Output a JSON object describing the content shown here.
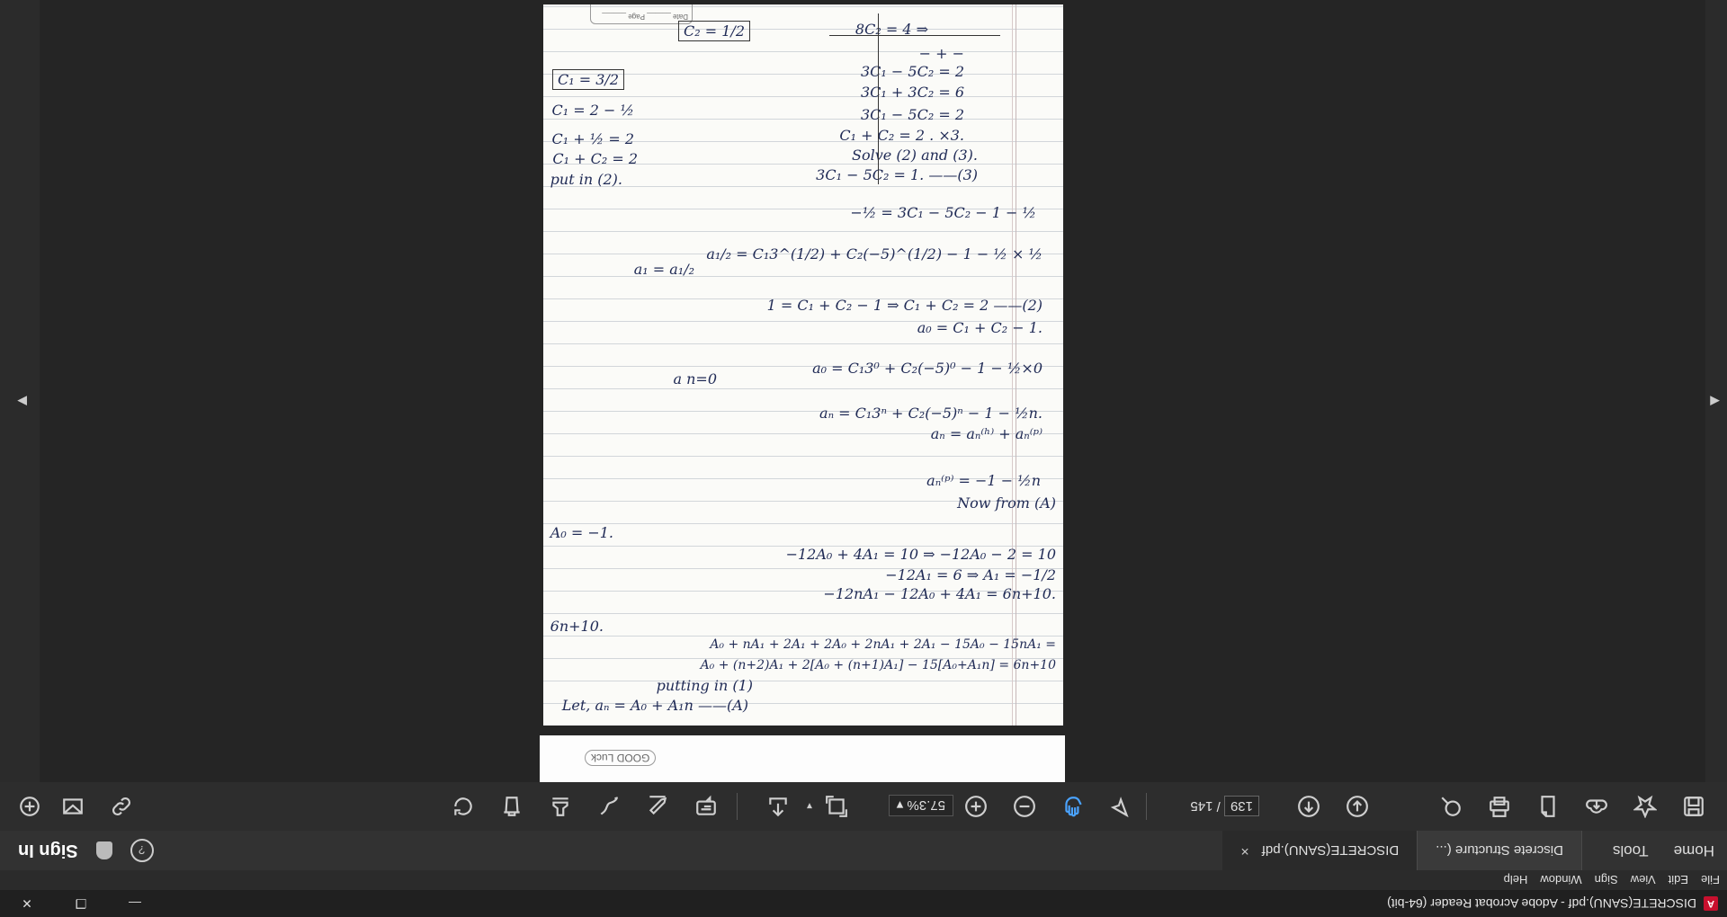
{
  "window": {
    "title": "DISCRETE(SANU).pdf - Adobe Acrobat Reader (64-bit)"
  },
  "menu": [
    "File",
    "Edit",
    "View",
    "Sign",
    "Window",
    "Help"
  ],
  "nav": {
    "home": "Home",
    "tools": "Tools"
  },
  "tabs": [
    {
      "label": "Discrete Structure (..."
    },
    {
      "label": "DISCRETE(SANU).pdf",
      "close": "×"
    }
  ],
  "header": {
    "sign_in": "Sign In",
    "help_icon": "?"
  },
  "toolbar": {
    "page_current": "139",
    "page_separator": "/",
    "page_total": "145",
    "zoom": "57.3%"
  },
  "document": {
    "header_box": "Date ______ Page ______",
    "prev_page_stamp": "GOOD Luck",
    "lines": [
      "Let,   aₙ = A₀ + A₁n  ——(A)",
      "putting in (1)",
      "A₀ + (n+2)A₁ + 2[A₀ + (n+1)A₁] − 15[A₀+A₁n] = 6n+10",
      "A₀ + nA₁ + 2A₁ + 2A₀ + 2nA₁ + 2A₁ − 15A₀ − 15nA₁ =",
      "6n+10.",
      "−12nA₁ − 12A₀ + 4A₁ = 6n+10.",
      "−12A₁ = 6  ⇒  A₁ = −1/2",
      "−12A₀ + 4A₁ = 10  ⇒  −12A₀ − 2 = 10",
      "A₀ = −1.",
      "Now from (A)",
      "aₙ⁽ᵖ⁾ = −1 − ½n",
      "aₙ = aₙ⁽ʰ⁾ + aₙ⁽ᵖ⁾",
      "aₙ = C₁3ⁿ + C₂(−5)ⁿ − 1 − ½n.",
      "a n=0",
      "a₀ = C₁3⁰ + C₂(−5)⁰ − 1 − ½×0",
      "a₀ = C₁ + C₂ − 1.",
      "1 = C₁ + C₂ − 1  ⇒  C₁ + C₂ = 2 ——(2)",
      "a₁ = a₁/₂",
      "a₁/₂ = C₁3^(1/2) + C₂(−5)^(1/2) − 1 − ½ × ½",
      "−½ = 3C₁ − 5C₂ − 1 − ½",
      "3C₁ − 5C₂ = 1.  ——(3)",
      "Solve (2) and (3).",
      "C₁ + C₂ = 2 . ×3.",
      "3C₁ − 5C₂ = 2",
      "3C₁ + 3C₂ = 6",
      "3C₁ − 5C₂ = 2",
      "− +  −",
      "8C₂ = 4  ⇒",
      "C₂ = 1/2",
      "put in (2).",
      "C₁ + C₂ = 2",
      "C₁ + ½ = 2",
      "C₁ = 2 − ½",
      "C₁ = 3/2"
    ]
  }
}
